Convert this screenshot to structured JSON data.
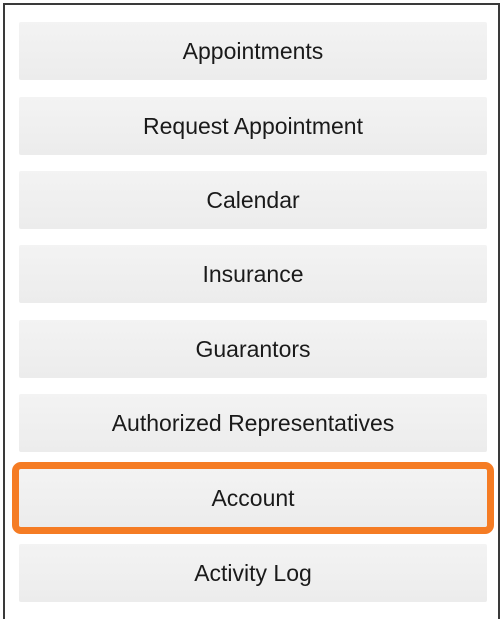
{
  "menu": {
    "items": [
      {
        "label": "Appointments"
      },
      {
        "label": "Request Appointment"
      },
      {
        "label": "Calendar"
      },
      {
        "label": "Insurance"
      },
      {
        "label": "Guarantors"
      },
      {
        "label": "Authorized Representatives"
      },
      {
        "label": "Account",
        "highlighted": true
      },
      {
        "label": "Activity Log"
      }
    ]
  },
  "colors": {
    "highlight": "#f57c24",
    "item_background": "#efefef",
    "text": "#1a1a1a"
  }
}
